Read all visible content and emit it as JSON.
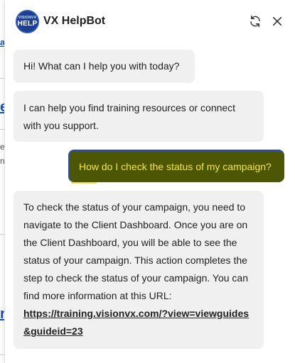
{
  "background": {
    "fragments": [
      "ai",
      "ec",
      "e",
      "ng",
      "r"
    ]
  },
  "header": {
    "avatar_top": "VISIONVX",
    "avatar_main": "HELP",
    "title": "VX HelpBot",
    "refresh_icon": "refresh-icon",
    "close_icon": "close-icon"
  },
  "messages": [
    {
      "sender": "bot",
      "text": "Hi! What can I help you with today?"
    },
    {
      "sender": "bot",
      "text": "I can help you find training resources or connect with you support."
    },
    {
      "sender": "user",
      "text": "How do I check the status of my campaign?"
    },
    {
      "sender": "bot",
      "text": "To check the status of your campaign, you need to navigate to the Client Dashboard. Once you are on the Client Dashboard, you will be able to see the status of your campaign. This action completes the step to check the status of your campaign. You can find more information at this URL:",
      "link": "https://training.visionvx.com/?view=viewguides&guideid=23"
    }
  ],
  "colors": {
    "user_bubble_bg": "#4d5605",
    "user_bubble_text": "#f3e54a",
    "bot_bubble_bg": "#f0f0f0",
    "accent": "#1d3f8f"
  }
}
